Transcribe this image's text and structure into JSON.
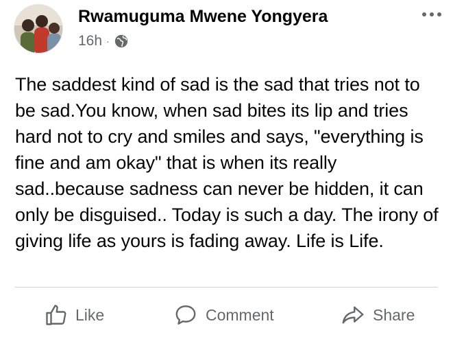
{
  "post": {
    "author": "Rwamuguma Mwene Yongyera",
    "time": "16h",
    "separator": "·",
    "audience_icon": "globe-icon",
    "text": "The saddest kind of sad is the sad that tries not to be sad.You know, when sad bites its lip and tries hard not to cry and smiles and says, \"everything is fine and am okay\" that is when its really sad..because sadness can never be hidden, it can only be disguised.. Today is such a day. The irony of giving life as yours is fading away. Life is Life."
  },
  "actions": {
    "like_label": "Like",
    "comment_label": "Comment",
    "share_label": "Share"
  },
  "colors": {
    "text": "#050505",
    "secondary": "#65676b",
    "divider": "#ced0d4"
  }
}
